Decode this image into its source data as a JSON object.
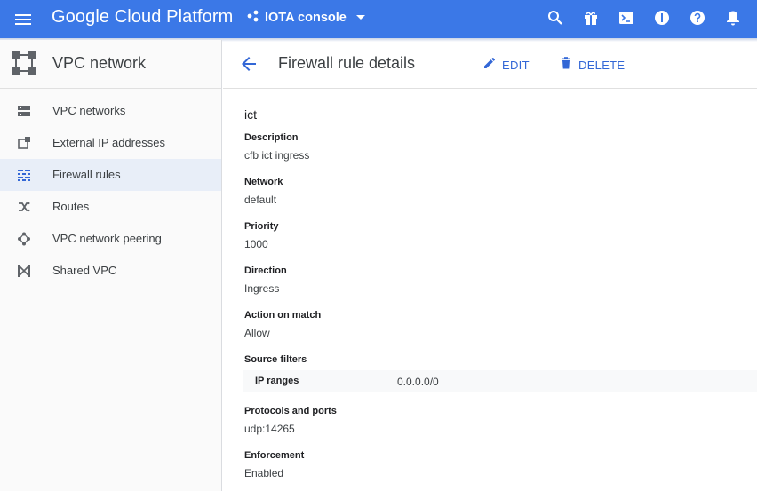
{
  "topbar": {
    "brand": "Google Cloud Platform",
    "project": "IOTA console",
    "icons": [
      "menu-icon",
      "search-icon",
      "gift-icon",
      "cloud-shell-icon",
      "feedback-icon",
      "help-icon",
      "notifications-icon"
    ]
  },
  "sidebar": {
    "title": "VPC network",
    "items": [
      {
        "label": "VPC networks",
        "icon": "vpc-networks-icon"
      },
      {
        "label": "External IP addresses",
        "icon": "external-ip-icon"
      },
      {
        "label": "Firewall rules",
        "icon": "firewall-icon",
        "active": true
      },
      {
        "label": "Routes",
        "icon": "routes-icon"
      },
      {
        "label": "VPC network peering",
        "icon": "peering-icon"
      },
      {
        "label": "Shared VPC",
        "icon": "shared-vpc-icon"
      }
    ]
  },
  "header": {
    "title": "Firewall rule details",
    "edit": "EDIT",
    "delete": "DELETE"
  },
  "rule": {
    "name": "ict",
    "fields": {
      "description": {
        "label": "Description",
        "value": "cfb ict ingress"
      },
      "network": {
        "label": "Network",
        "value": "default"
      },
      "priority": {
        "label": "Priority",
        "value": "1000"
      },
      "direction": {
        "label": "Direction",
        "value": "Ingress"
      },
      "action": {
        "label": "Action on match",
        "value": "Allow"
      },
      "source_filters": {
        "label": "Source filters",
        "key": "IP ranges",
        "value": "0.0.0.0/0"
      },
      "protocols": {
        "label": "Protocols and ports",
        "value": "udp:14265"
      },
      "enforcement": {
        "label": "Enforcement",
        "value": "Enabled"
      }
    }
  },
  "colors": {
    "topbar": "#3b78e7",
    "accent": "#3367d6",
    "active_nav": "#e8eef8"
  }
}
